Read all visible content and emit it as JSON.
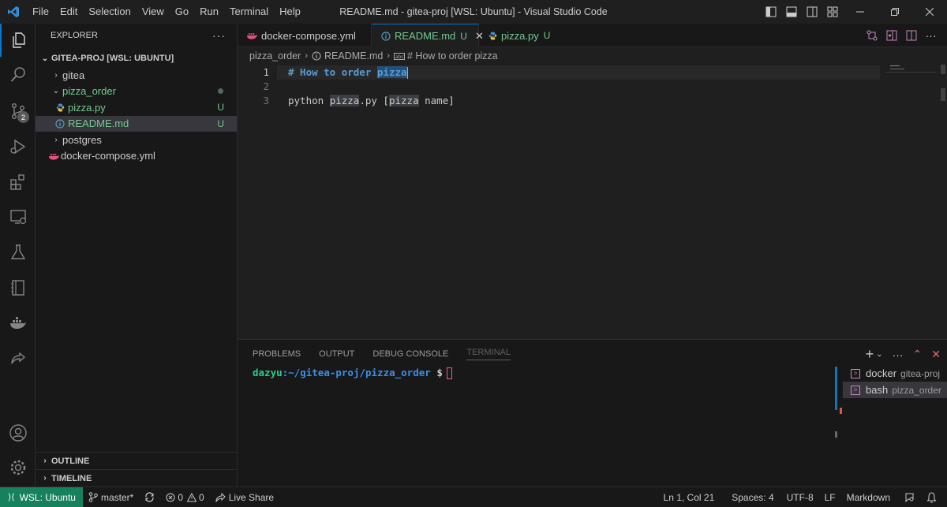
{
  "titlebar": {
    "menu": [
      "File",
      "Edit",
      "Selection",
      "View",
      "Go",
      "Run",
      "Terminal",
      "Help"
    ],
    "window_title": "README.md - gitea-proj [WSL: Ubuntu] - Visual Studio Code"
  },
  "activity": {
    "scm_badge": "2"
  },
  "sidebar": {
    "title": "EXPLORER",
    "more": "···",
    "workspace": "GITEA-PROJ [WSL: UBUNTU]",
    "items": [
      {
        "label": "gitea",
        "status": ""
      },
      {
        "label": "pizza_order",
        "status": ""
      },
      {
        "label": "pizza.py",
        "status": "U"
      },
      {
        "label": "README.md",
        "status": "U"
      },
      {
        "label": "postgres",
        "status": ""
      },
      {
        "label": "docker-compose.yml",
        "status": ""
      }
    ],
    "outline": "OUTLINE",
    "timeline": "TIMELINE"
  },
  "tabs": [
    {
      "label": "docker-compose.yml",
      "status": ""
    },
    {
      "label": "README.md",
      "status": "U"
    },
    {
      "label": "pizza.py",
      "status": "U"
    }
  ],
  "breadcrumb": {
    "folder": "pizza_order",
    "file": "README.md",
    "symbol": "# How to order pizza"
  },
  "editor": {
    "line_numbers": [
      "1",
      "2",
      "3"
    ],
    "line1_hash": "# How to order ",
    "line1_word": "pizza",
    "line3_a": "python ",
    "line3_b": "pizza",
    "line3_c": ".py [",
    "line3_d": "pizza",
    "line3_e": " name]"
  },
  "panel": {
    "tabs": [
      "PROBLEMS",
      "OUTPUT",
      "DEBUG CONSOLE",
      "TERMINAL"
    ],
    "prompt_user": "dazyu",
    "prompt_path": ":~/gitea-proj/pizza_order",
    "prompt_sign": " $",
    "terminals": [
      {
        "name": "docker",
        "cwd": "gitea-proj"
      },
      {
        "name": "bash",
        "cwd": "pizza_order"
      }
    ]
  },
  "status": {
    "remote": "WSL: Ubuntu",
    "branch": "master*",
    "errors": "0",
    "warnings": "0",
    "liveshare": "Live Share",
    "position": "Ln 1, Col 21",
    "spaces": "Spaces: 4",
    "encoding": "UTF-8",
    "eol": "LF",
    "language": "Markdown"
  },
  "colors": {
    "accent": "#0078d4",
    "untracked": "#73c991",
    "remote_bg": "#16825d",
    "heading": "#569cd6"
  }
}
